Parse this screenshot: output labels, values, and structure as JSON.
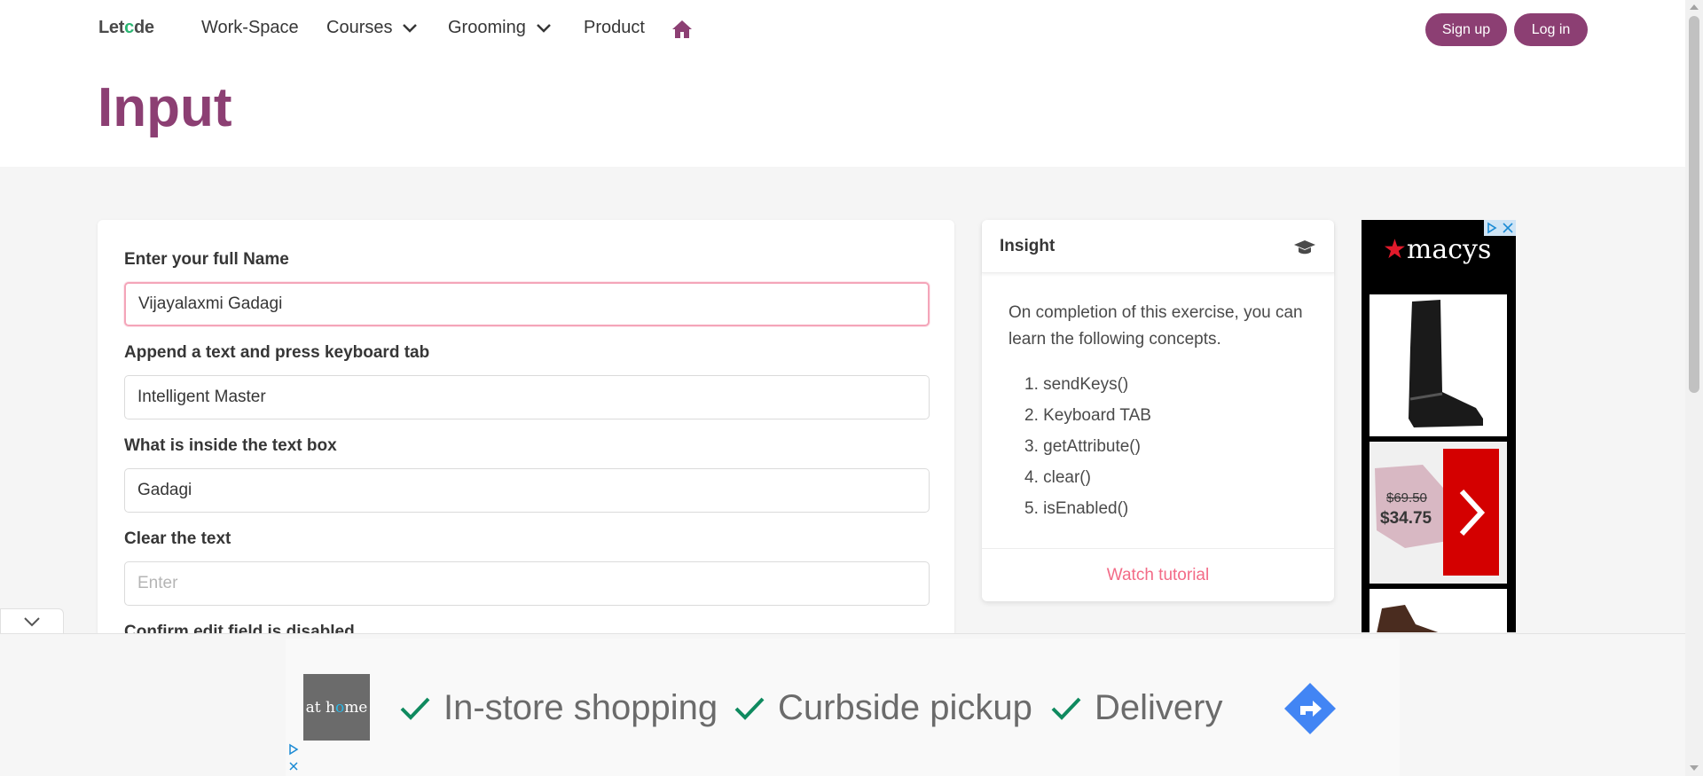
{
  "navbar": {
    "brand_pre": "Let",
    "brand_o": "c",
    "brand_post": "de",
    "items": [
      {
        "label": "Work-Space",
        "dropdown": false
      },
      {
        "label": "Courses",
        "dropdown": true
      },
      {
        "label": "Grooming",
        "dropdown": true
      },
      {
        "label": "Product",
        "dropdown": false
      }
    ],
    "signup_label": "Sign up",
    "login_label": "Log in",
    "accent": "#8c3f73"
  },
  "page": {
    "title": "Input"
  },
  "form": {
    "fields": [
      {
        "label": "Enter your full Name",
        "value": "Vijayalaxmi Gadagi",
        "placeholder": ""
      },
      {
        "label": "Append a text and press keyboard tab",
        "value": "Intelligent Master",
        "placeholder": ""
      },
      {
        "label": "What is inside the text box",
        "value": "Gadagi",
        "placeholder": ""
      },
      {
        "label": "Clear the text",
        "value": "",
        "placeholder": "Enter"
      },
      {
        "label": "Confirm edit field is disabled"
      }
    ]
  },
  "insight": {
    "title": "Insight",
    "description": "On completion of this exercise, you can learn the following concepts.",
    "concepts": [
      "1. sendKeys()",
      "2. Keyboard TAB",
      "3. getAttribute()",
      "4. clear()",
      "5. isEnabled()"
    ],
    "footer_link": "Watch tutorial",
    "link_color": "#f36b87"
  },
  "side_ad": {
    "brand": "macys",
    "price_old": "$69.50",
    "price_new": "$34.75"
  },
  "bottom_ad": {
    "logo_pre": "at h",
    "logo_o": "o",
    "logo_post": "me",
    "features": [
      "In-store shopping",
      "Curbside pickup",
      "Delivery"
    ],
    "check_color": "#0f8a5f",
    "direction_color": "#4285f4"
  }
}
